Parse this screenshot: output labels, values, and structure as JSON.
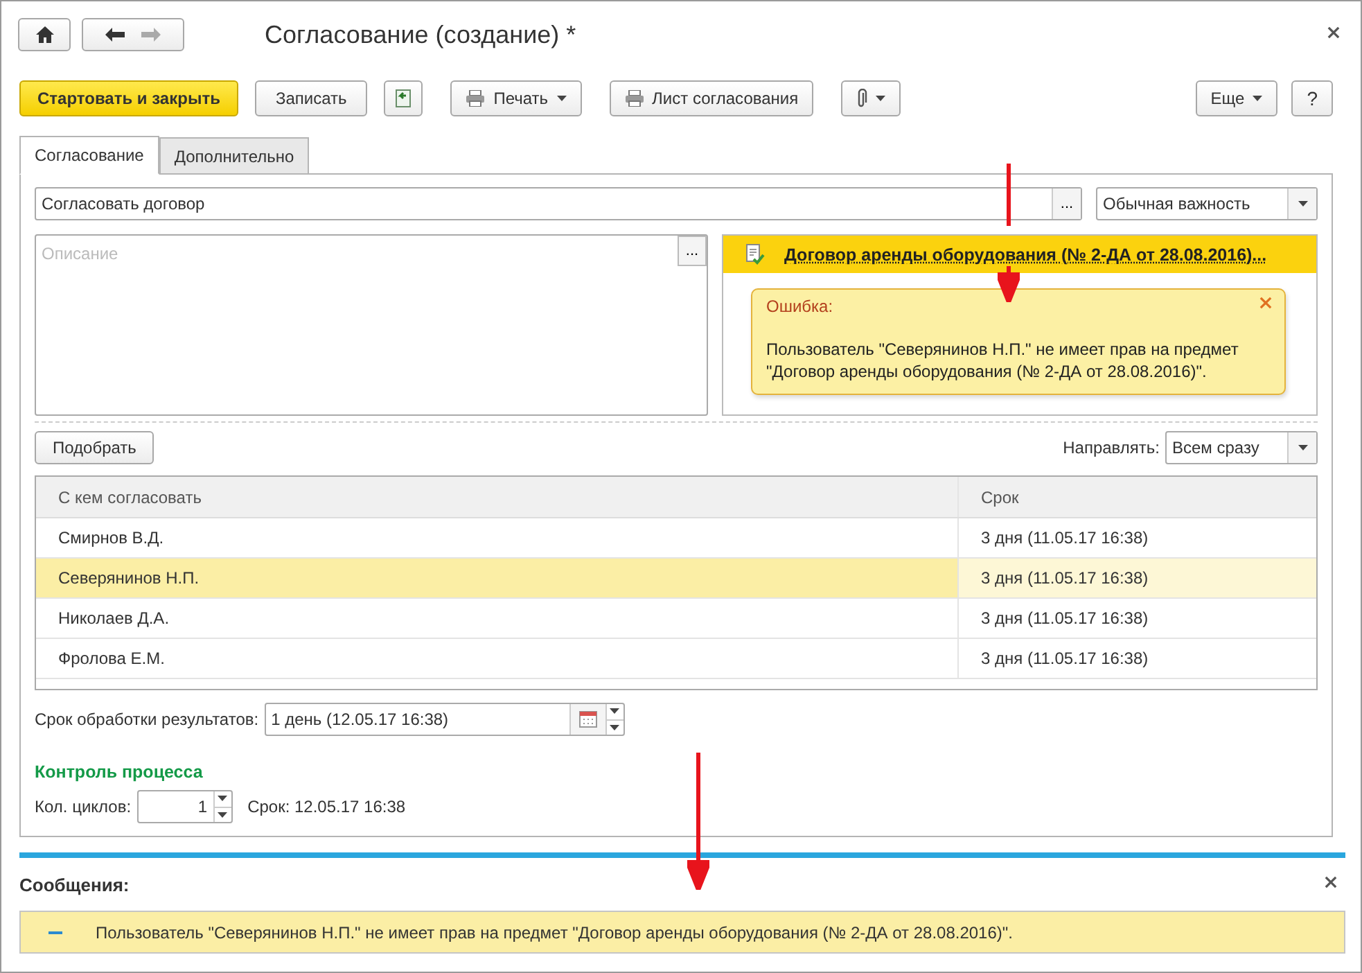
{
  "window": {
    "title": "Согласование (создание) *"
  },
  "toolbar": [
    {
      "kind": "primary",
      "label": "Стартовать и закрыть"
    },
    {
      "kind": "plain",
      "label": "Записать"
    },
    {
      "kind": "doc-icon"
    },
    {
      "kind": "print-menu",
      "label": "Печать"
    },
    {
      "kind": "print",
      "label": "Лист согласования"
    },
    {
      "kind": "clip-menu"
    }
  ],
  "more": {
    "label": "Еще"
  },
  "help": {
    "label": "?"
  },
  "tabs": [
    {
      "label": "Согласование",
      "selected": true
    },
    {
      "label": "Дополнительно",
      "selected": false
    }
  ],
  "subject": {
    "value": "Согласовать договор",
    "button": "..."
  },
  "importance": {
    "value": "Обычная важность"
  },
  "description": {
    "placeholder": "Описание",
    "button": "..."
  },
  "document": {
    "link": "Договор аренды оборудования (№ 2-ДА от 28.08.2016)..."
  },
  "error": {
    "title": "Ошибка:",
    "text": "Пользователь \"Северянинов Н.П.\" не имеет прав на предмет \"Договор аренды оборудования (№ 2-ДА от 28.08.2016)\"."
  },
  "pick_button": "Подобрать",
  "direction": {
    "label": "Направлять:",
    "value": "Всем сразу"
  },
  "table": {
    "columns": [
      "С кем согласовать",
      "Срок"
    ],
    "rows": [
      {
        "name": "Смирнов В.Д.",
        "term": "3 дня (11.05.17 16:38)",
        "selected": false
      },
      {
        "name": "Северянинов Н.П.",
        "term": "3 дня (11.05.17 16:38)",
        "selected": true
      },
      {
        "name": "Николаев Д.А.",
        "term": "3 дня (11.05.17 16:38)",
        "selected": false
      },
      {
        "name": "Фролова Е.М.",
        "term": "3 дня (11.05.17 16:38)",
        "selected": false
      }
    ]
  },
  "result_term": {
    "label": "Срок обработки результатов:",
    "value": "1 день (12.05.17 16:38)"
  },
  "process": {
    "title": "Контроль процесса",
    "cycles_label": "Кол. циклов:",
    "cycles": "1",
    "deadline": "Срок: 12.05.17 16:38"
  },
  "messages": {
    "title": "Сообщения:",
    "items": [
      "Пользователь \"Северянинов Н.П.\" не имеет прав на предмет \"Договор аренды оборудования (№ 2-ДА от 28.08.2016)\"."
    ]
  }
}
